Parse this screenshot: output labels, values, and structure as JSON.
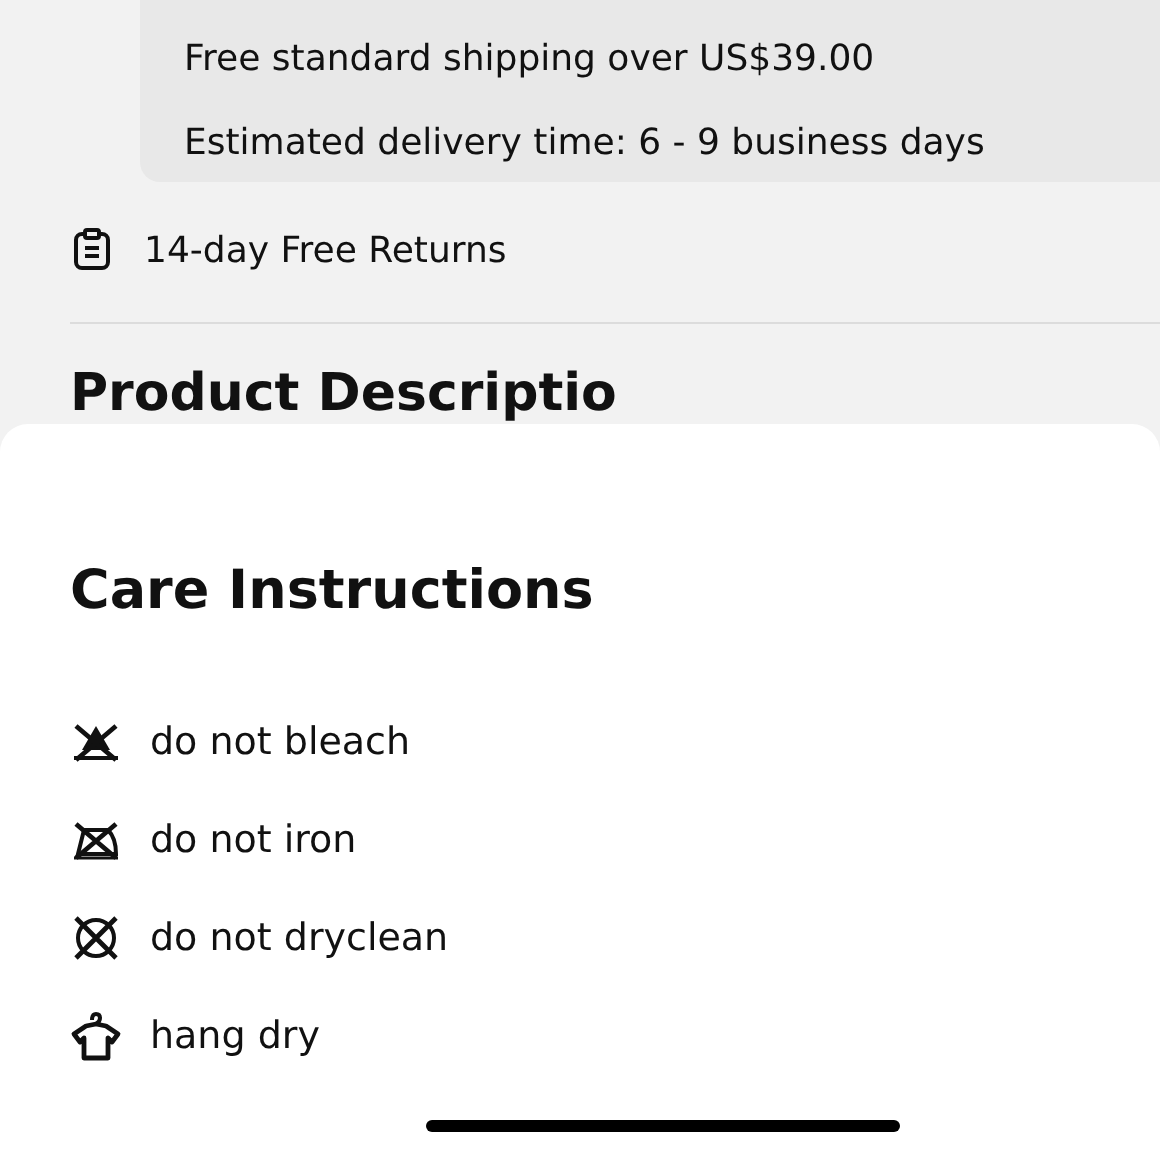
{
  "shipping": {
    "lines": [
      "Free standard shipping over US$39.00",
      "Estimated delivery time: 6 - 9 business days"
    ]
  },
  "returns": {
    "label": "14-day Free Returns"
  },
  "section_heading": "Product Descriptio",
  "sheet": {
    "title": "Care Instructions",
    "items": [
      {
        "kind": "no-bleach",
        "label": "do not bleach"
      },
      {
        "kind": "no-iron",
        "label": "do not iron"
      },
      {
        "kind": "no-dryclean",
        "label": "do not dryclean"
      },
      {
        "kind": "hang-dry",
        "label": "hang dry"
      }
    ]
  }
}
